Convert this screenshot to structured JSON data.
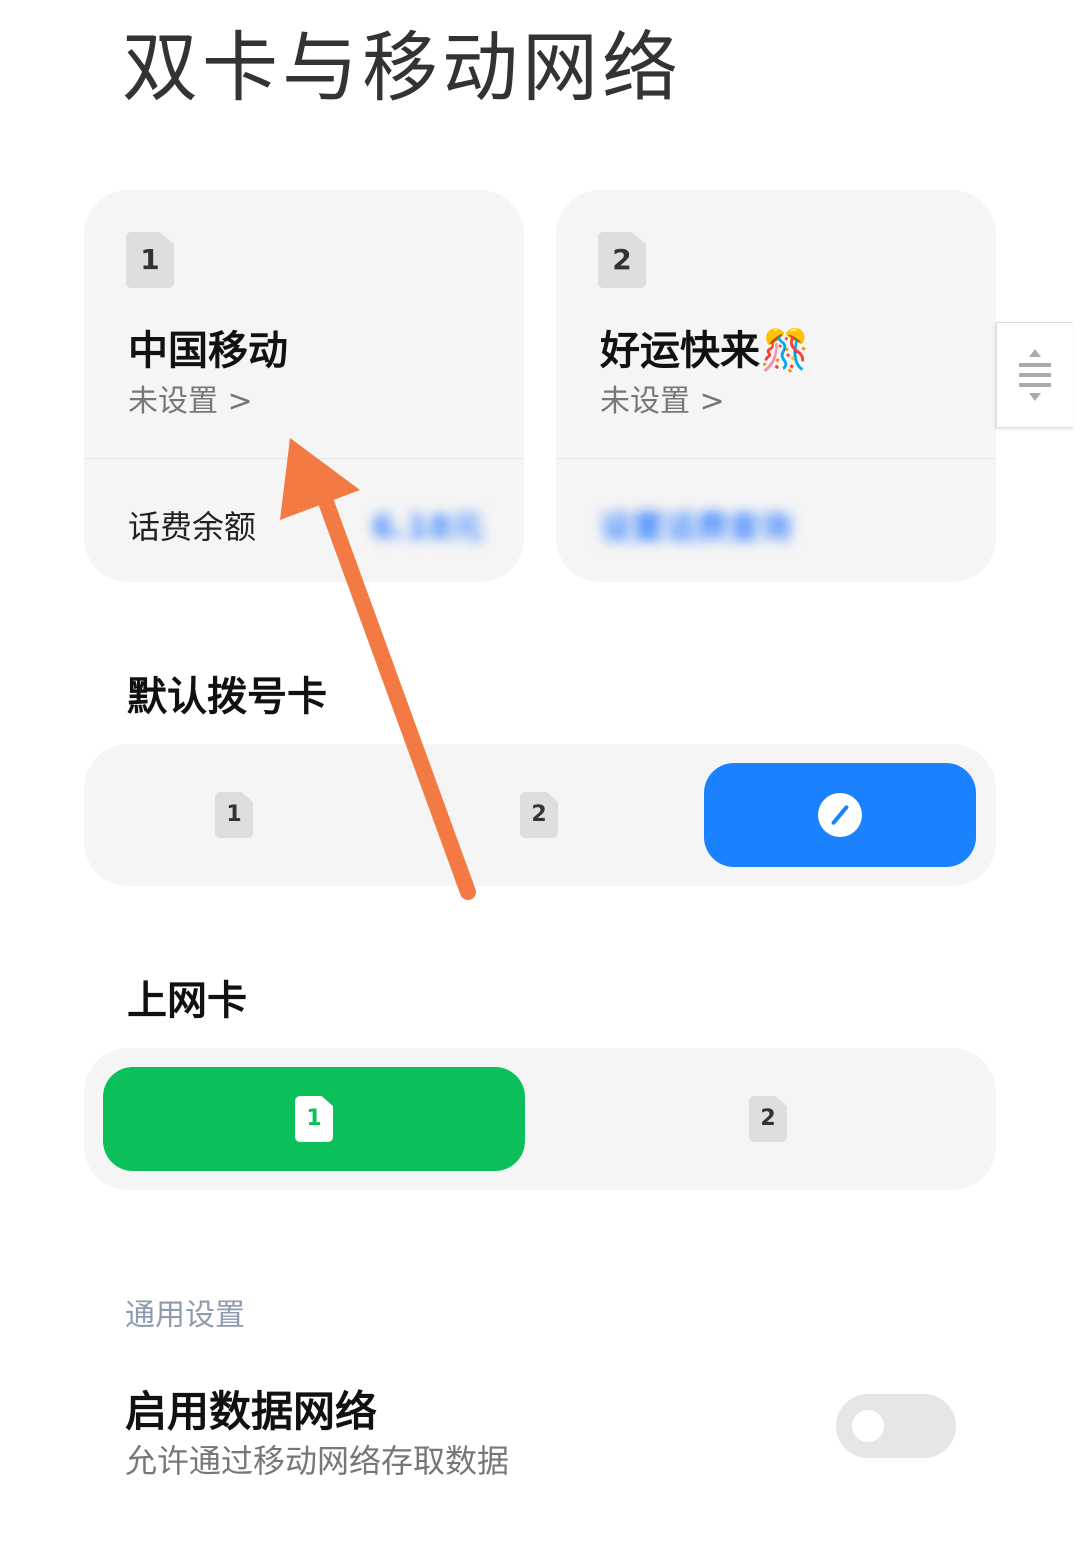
{
  "page": {
    "title": "双卡与移动网络"
  },
  "sim_cards": [
    {
      "slot": "1",
      "carrier": "中国移动",
      "status": "未设置 >",
      "balance_label": "话费余额",
      "balance_value": "6.18元"
    },
    {
      "slot": "2",
      "carrier": "好运快来🎊",
      "status": "未设置 >",
      "balance_value": "设置话费查询"
    }
  ],
  "default_dial": {
    "label": "默认拨号卡",
    "options": [
      "1",
      "2"
    ],
    "selected": "edit",
    "selected_color": "#1A82FF"
  },
  "data_card": {
    "label": "上网卡",
    "options": [
      "1",
      "2"
    ],
    "selected": "1",
    "selected_color": "#0BBF5A"
  },
  "general": {
    "header": "通用设置",
    "enable_data_title": "启用数据网络",
    "enable_data_desc": "允许通过移动网络存取数据",
    "enable_data_on": false
  },
  "annotation": {
    "arrow_color": "#F47A44"
  }
}
